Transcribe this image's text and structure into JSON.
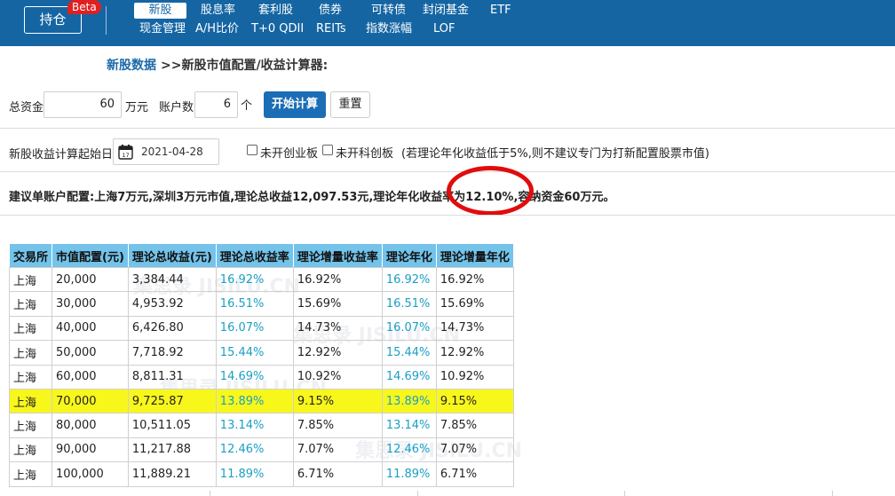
{
  "nav": {
    "holdings_button": "持仓",
    "beta_badge": "Beta",
    "row1": [
      "新股",
      "股息率",
      "套利股",
      "债券",
      "可转债",
      "封闭基金",
      "ETF"
    ],
    "row2": [
      "现金管理",
      "A/H比价",
      "T+0 QDII",
      "REITs",
      "指数涨幅",
      "LOF"
    ],
    "active": "新股"
  },
  "breadcrumb": {
    "link": "新股数据",
    "text": ">>新股市值配置/收益计算器:"
  },
  "form": {
    "total_funds_label": "总资金",
    "total_funds_value": "60",
    "total_funds_unit": "万元",
    "accounts_label": "账户数",
    "accounts_value": "6",
    "accounts_unit": "个",
    "calc_button": "开始计算",
    "reset_button": "重置",
    "start_date_label": "新股收益计算起始日",
    "start_date_value": "2021-04-28",
    "chk_chinext": "未开创业板",
    "chk_star": "未开科创板",
    "note": "(若理论年化收益低于5%,则不建议专门为打新配置股票市值)"
  },
  "suggestion": "建议单账户配置:上海7万元,深圳3万元市值,理论总收益12,097.53元,理论年化收益率为12.10%,容纳资金60万元。",
  "watermark": "集思录 JISILU.CN",
  "table": {
    "headers": [
      "交易所",
      "市值配置(元)",
      "理论总收益(元)",
      "理论总收益率",
      "理论增量收益率",
      "理论年化",
      "理论增量年化"
    ],
    "rows": [
      [
        "上海",
        "20,000",
        "3,384.44",
        "16.92%",
        "16.92%",
        "16.92%",
        "16.92%"
      ],
      [
        "上海",
        "30,000",
        "4,953.92",
        "16.51%",
        "15.69%",
        "16.51%",
        "15.69%"
      ],
      [
        "上海",
        "40,000",
        "6,426.80",
        "16.07%",
        "14.73%",
        "16.07%",
        "14.73%"
      ],
      [
        "上海",
        "50,000",
        "7,718.92",
        "15.44%",
        "12.92%",
        "15.44%",
        "12.92%"
      ],
      [
        "上海",
        "60,000",
        "8,811.31",
        "14.69%",
        "10.92%",
        "14.69%",
        "10.92%"
      ],
      [
        "上海",
        "70,000",
        "9,725.87",
        "13.89%",
        "9.15%",
        "13.89%",
        "9.15%"
      ],
      [
        "上海",
        "80,000",
        "10,511.05",
        "13.14%",
        "7.85%",
        "13.14%",
        "7.85%"
      ],
      [
        "上海",
        "90,000",
        "11,217.88",
        "12.46%",
        "7.07%",
        "12.46%",
        "7.07%"
      ],
      [
        "上海",
        "100,000",
        "11,889.21",
        "11.89%",
        "6.71%",
        "11.89%",
        "6.71%"
      ]
    ],
    "highlight_row": 5
  },
  "colors": {
    "nav_bg": "#1565a3",
    "header_bg": "#73c3ea",
    "highlight": "#f8f71c",
    "teal_value": "#1b9fc4",
    "annotation": "#e10c0c"
  }
}
